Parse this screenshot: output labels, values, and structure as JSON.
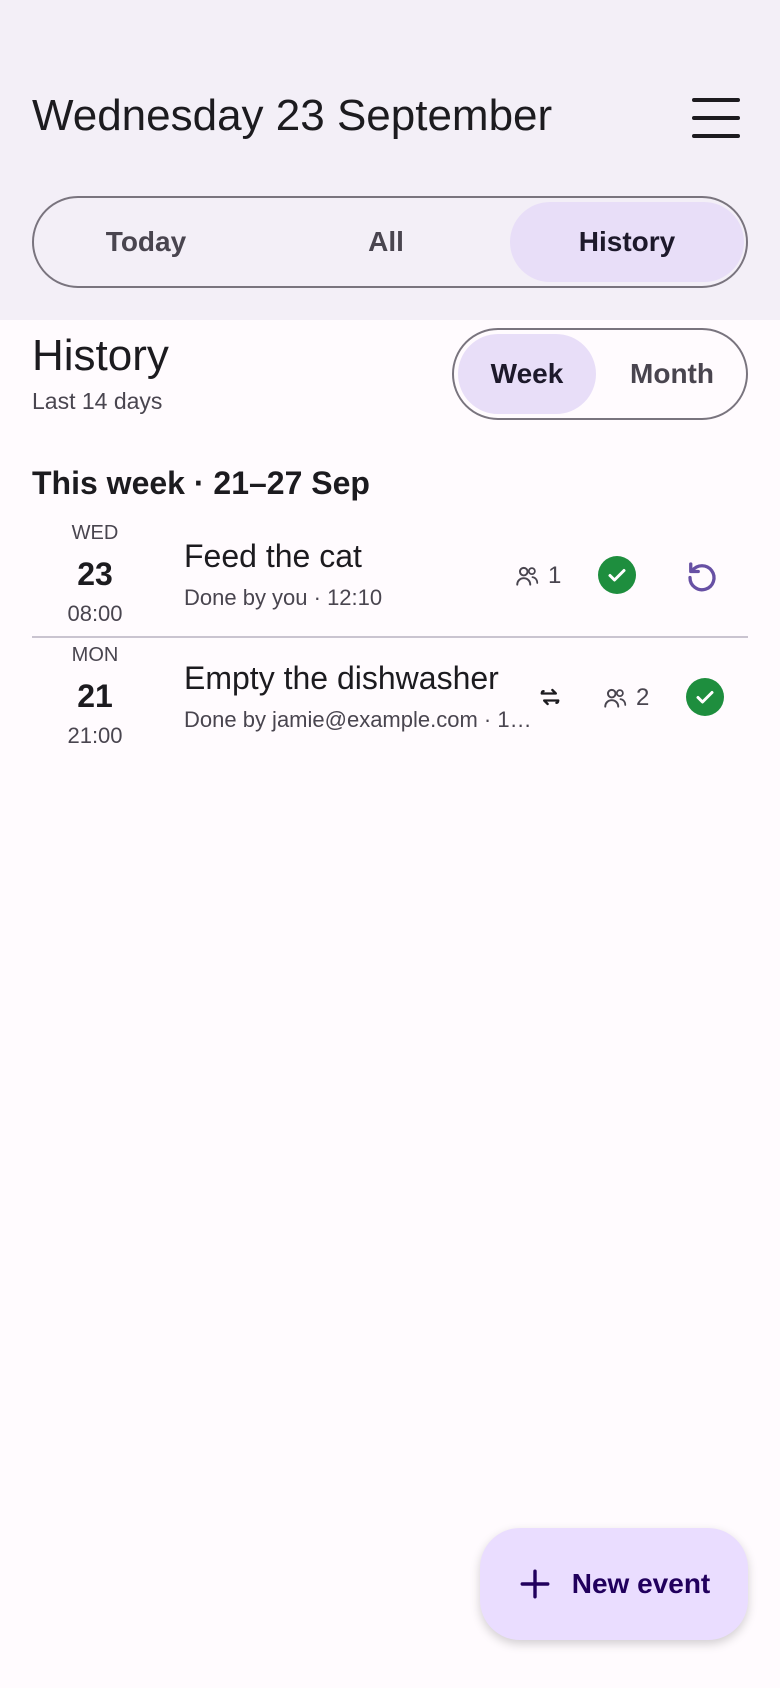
{
  "header": {
    "title": "Wednesday 23 September"
  },
  "tabs": [
    {
      "label": "Today",
      "selected": false
    },
    {
      "label": "All",
      "selected": false
    },
    {
      "label": "History",
      "selected": true
    }
  ],
  "history": {
    "title": "History",
    "subtitle": "Last 14 days",
    "range_options": [
      {
        "label": "Week",
        "selected": true
      },
      {
        "label": "Month",
        "selected": false
      }
    ],
    "section_heading": "This week · 21–27 Sep",
    "events": [
      {
        "day_of_week": "WED",
        "day": "23",
        "time": "08:00",
        "title": "Feed the cat",
        "subtitle": "Done by you · 12:10",
        "participants": "1",
        "repeating": false,
        "done": true,
        "undo": true
      },
      {
        "day_of_week": "MON",
        "day": "21",
        "time": "21:00",
        "title": "Empty the dishwasher",
        "subtitle": "Done by jamie@example.com · 1…",
        "participants": "2",
        "repeating": true,
        "done": true,
        "undo": false
      }
    ]
  },
  "fab": {
    "label": "New event",
    "icon": "plus-icon"
  },
  "colors": {
    "header_bg": "#f3eff7",
    "selected_segment": "#e8def8",
    "done_green": "#1e8e3e",
    "accent_purple": "#6750a4",
    "fab_bg": "#eaddff"
  }
}
